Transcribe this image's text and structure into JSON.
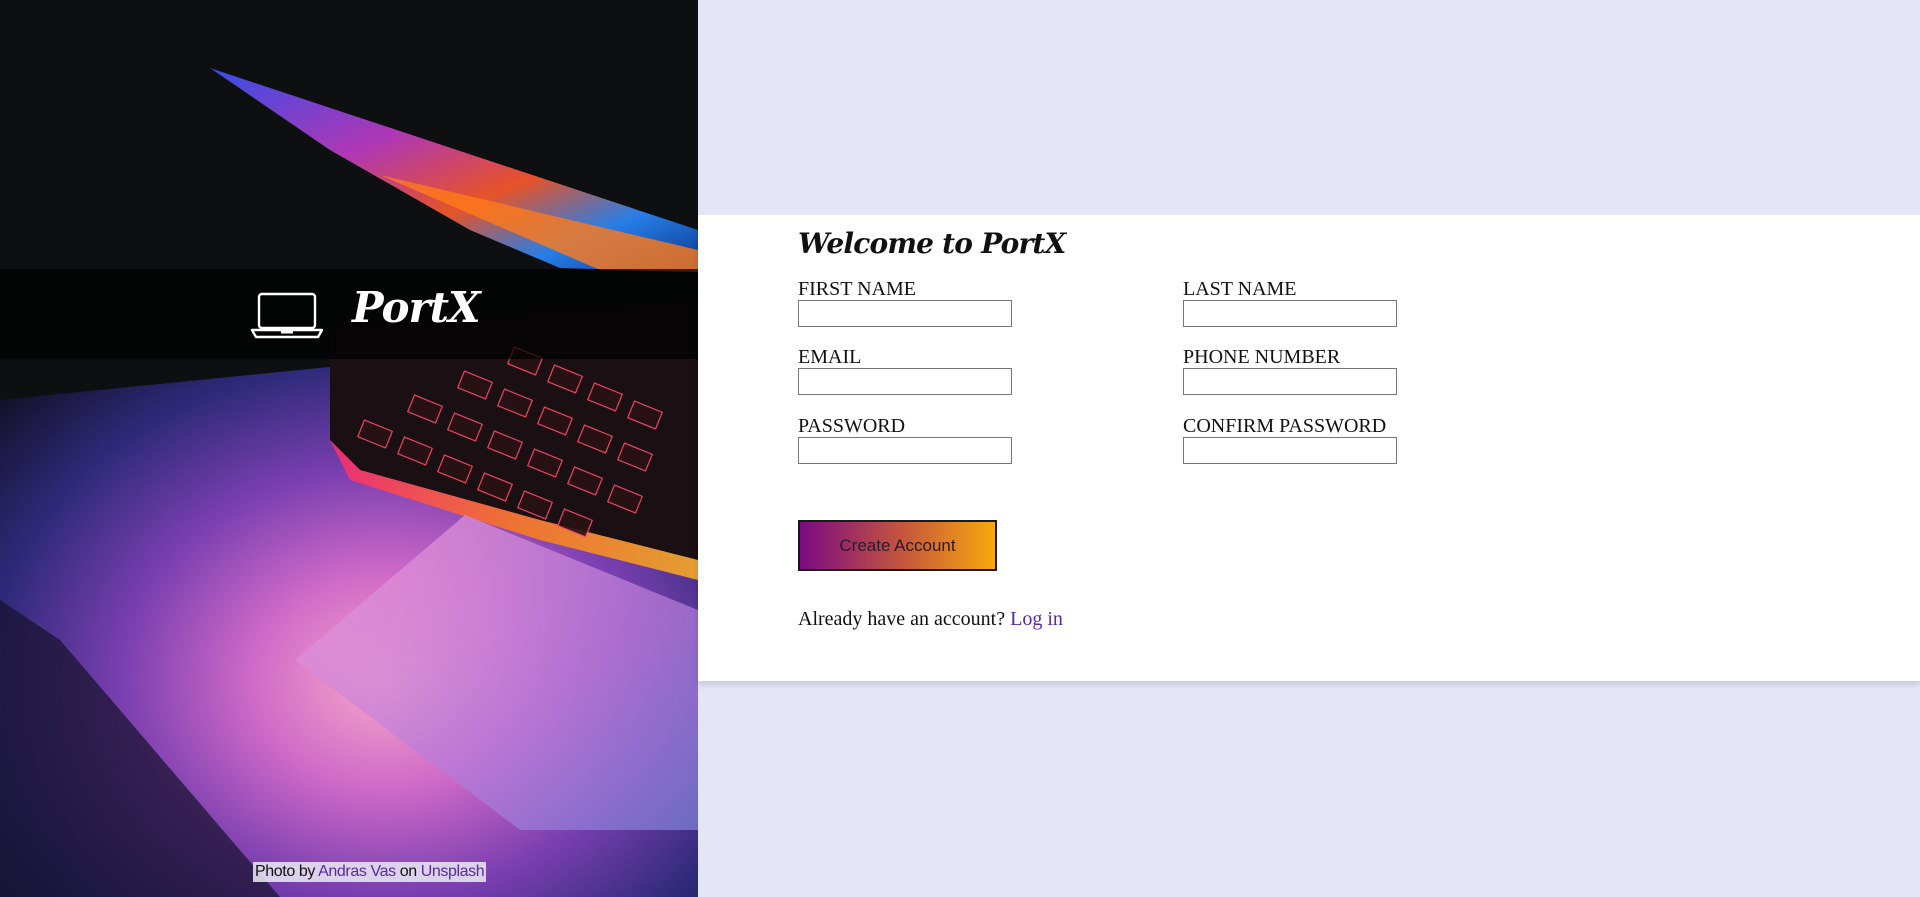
{
  "brand": {
    "name": "PortX",
    "icon": "laptop-icon"
  },
  "credit": {
    "prefix": "Photo by",
    "author": "Andras Vas",
    "middle": "on",
    "site": "Unsplash"
  },
  "form": {
    "title": "Welcome to PortX",
    "fields": {
      "first_name": {
        "label": "FIRST NAME",
        "value": ""
      },
      "last_name": {
        "label": "LAST NAME",
        "value": ""
      },
      "email": {
        "label": "EMAIL",
        "value": ""
      },
      "phone": {
        "label": "PHONE NUMBER",
        "value": ""
      },
      "password": {
        "label": "PASSWORD",
        "value": ""
      },
      "confirm_password": {
        "label": "CONFIRM PASSWORD",
        "value": ""
      }
    },
    "submit_label": "Create Account",
    "login_prompt": "Already have an account?",
    "login_link": "Log in"
  },
  "colors": {
    "page_background": "#e5e5f8",
    "card_background": "#ffffff",
    "link": "#5b2a9a",
    "button_gradient_start": "#7a0a82",
    "button_gradient_end": "#f7a90a"
  }
}
